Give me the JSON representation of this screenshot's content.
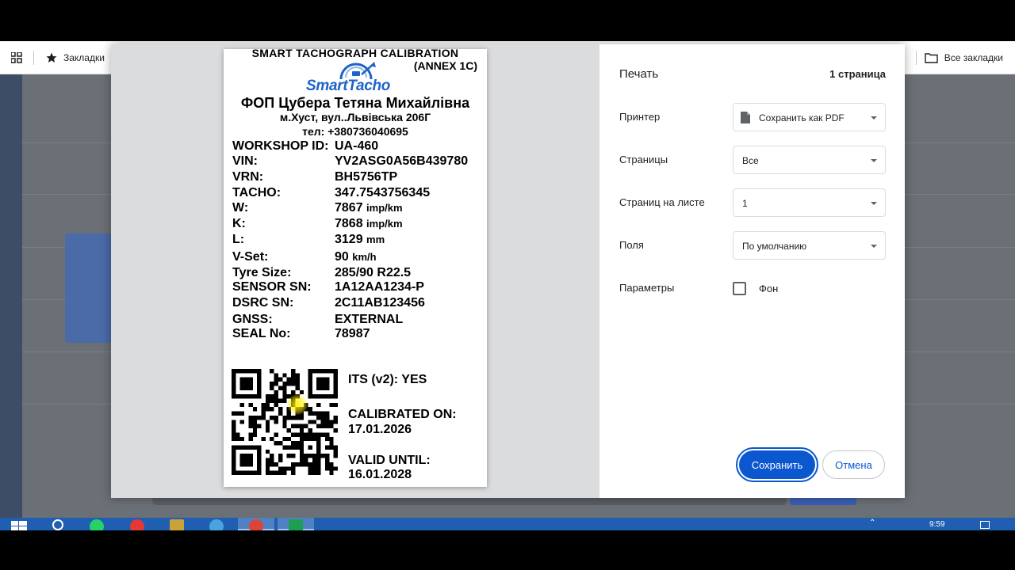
{
  "bookmarks_bar": {
    "apps_icon": "apps-grid-icon",
    "bookmarks_label": "Закладки",
    "all_bookmarks_label": "Все закладки"
  },
  "receipt": {
    "title_line1": "SMART TACHOGRAPH CALIBRATION",
    "title_line2": "(ANNEX 1C)",
    "logo_text": "SmartTacho",
    "company": "ФОП Цубера Тетяна Михайлівна",
    "address": "м.Хуст, вул..Львівська 206Г",
    "phone": "тел: +380736040695",
    "fields": [
      {
        "key": "WORKSHOP ID:",
        "value": "UA-460",
        "unit": ""
      },
      {
        "key": "VIN:",
        "value": "YV2ASG0A56B439780",
        "unit": ""
      },
      {
        "key": "VRN:",
        "value": "BH5756TP",
        "unit": ""
      },
      {
        "key": "TACHO:",
        "value": "347.7543756345",
        "unit": ""
      },
      {
        "key": "W:",
        "value": "7867",
        "unit": "imp/km"
      },
      {
        "key": "K:",
        "value": "7868",
        "unit": "imp/km"
      },
      {
        "key": "L:",
        "value": "3129",
        "unit": "mm"
      },
      {
        "key": "V-Set:",
        "value": "90",
        "unit": "km/h"
      },
      {
        "key": "Tyre Size:",
        "value": "285/90 R22.5",
        "unit": ""
      },
      {
        "key": "SENSOR SN:",
        "value": "1A12AA1234-P",
        "unit": ""
      },
      {
        "key": "DSRC SN:",
        "value": "2C11AB123456",
        "unit": ""
      },
      {
        "key": "GNSS:",
        "value": "EXTERNAL",
        "unit": ""
      },
      {
        "key": "SEAL No:",
        "value": "78987",
        "unit": ""
      }
    ],
    "its_line": "ITS (v2):   YES",
    "calibrated_label": "CALIBRATED ON:",
    "calibrated_date": "17.01.2026",
    "valid_label": "VALID UNTIL:",
    "valid_date": "16.01.2028"
  },
  "print_dialog": {
    "title": "Печать",
    "page_count": "1 страница",
    "printer_label": "Принтер",
    "printer_value": "Сохранить как PDF",
    "pages_label": "Страницы",
    "pages_value": "Все",
    "pages_per_sheet_label": "Страниц на листе",
    "pages_per_sheet_value": "1",
    "margins_label": "Поля",
    "margins_value": "По умолчанию",
    "options_label": "Параметры",
    "background_label": "Фон",
    "background_checked": false,
    "save_label": "Сохранить",
    "cancel_label": "Отмена"
  },
  "taskbar": {
    "clock": "9:59"
  },
  "colors": {
    "primary_button": "#0b57d0",
    "logo_blue": "#1e63c8",
    "taskbar": "#1f5eb1"
  }
}
